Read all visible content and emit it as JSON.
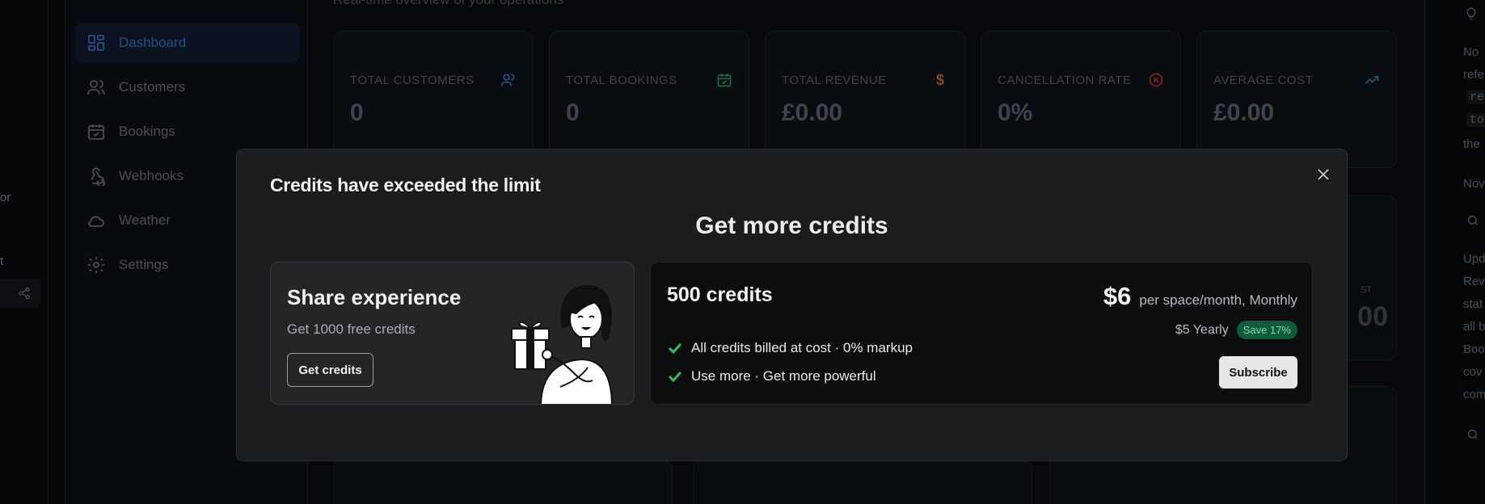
{
  "background": {
    "left_fragments": [
      "or",
      "t"
    ],
    "header_partial": "Real-time overview of your operations",
    "sidebar": {
      "items": [
        {
          "label": "Dashboard",
          "icon": "dashboard-icon",
          "active": true
        },
        {
          "label": "Customers",
          "icon": "users-icon"
        },
        {
          "label": "Bookings",
          "icon": "calendar-icon"
        },
        {
          "label": "Webhooks",
          "icon": "webhook-icon"
        },
        {
          "label": "Weather",
          "icon": "cloud-icon"
        },
        {
          "label": "Settings",
          "icon": "gear-icon"
        }
      ]
    },
    "stats": [
      {
        "label": "TOTAL CUSTOMERS",
        "value": "0",
        "icon": "users-icon",
        "color": "#2a4e8a"
      },
      {
        "label": "TOTAL BOOKINGS",
        "value": "0",
        "icon": "calendar-check-icon",
        "color": "#1f6b3f"
      },
      {
        "label": "TOTAL REVENUE",
        "value": "£0.00",
        "icon": "dollar-icon",
        "color": "#8a4a1c"
      },
      {
        "label": "CANCELLATION RATE",
        "value": "0%",
        "icon": "x-circle-icon",
        "color": "#8a1f24"
      },
      {
        "label": "AVERAGE COST",
        "value": "£0.00",
        "icon": "trending-up-icon",
        "color": "#1f5a6b"
      }
    ],
    "stat_partial": {
      "label_fragment": "ST",
      "value_fragment": "00"
    },
    "right_fragments": [
      "No",
      "refe",
      "re",
      "to",
      "the",
      "Nov",
      "Upd",
      "Rev",
      "stat",
      "all b",
      "Boo",
      "cov",
      "com"
    ]
  },
  "modal": {
    "title": "Credits have exceeded the limit",
    "subtitle": "Get more credits",
    "share": {
      "heading": "Share experience",
      "description": "Get 1000 free credits",
      "button": "Get credits"
    },
    "plan": {
      "name": "500 credits",
      "price": "$6",
      "price_desc": "per space/month, Monthly",
      "yearly": "$5 Yearly",
      "save_badge": "Save 17%",
      "features": [
        "All credits billed at cost · 0% markup",
        "Use more · Get more powerful"
      ],
      "subscribe": "Subscribe"
    }
  }
}
